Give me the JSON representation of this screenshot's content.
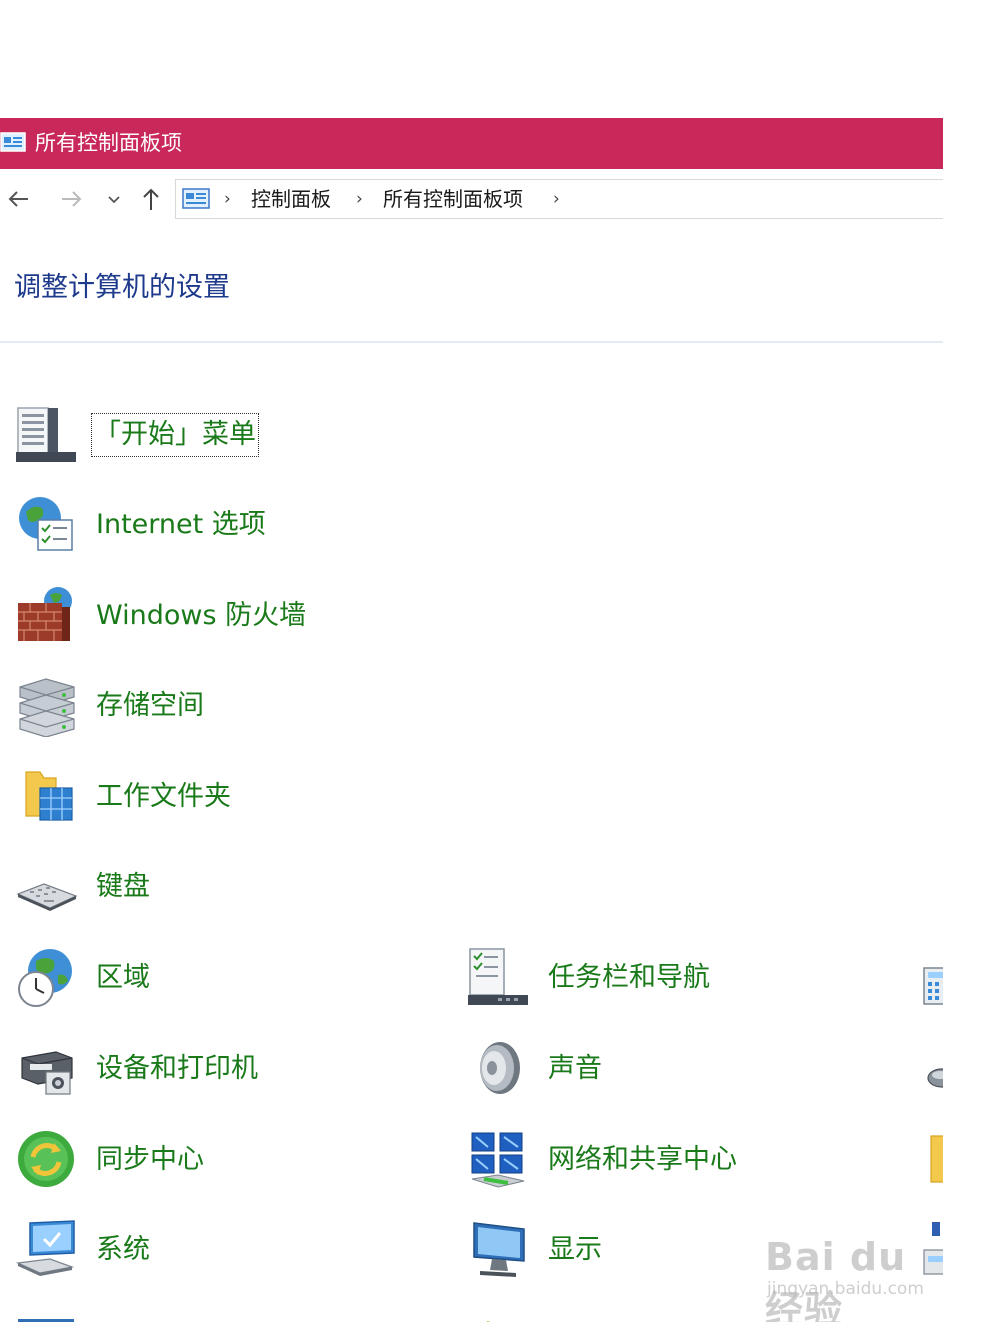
{
  "window": {
    "title": "所有控制面板项"
  },
  "navbar": {
    "back_icon": "arrow-left-icon",
    "forward_icon": "arrow-right-icon",
    "recent_icon": "chevron-down-icon",
    "up_icon": "arrow-up-icon",
    "breadcrumb": [
      "控制面板",
      "所有控制面板项"
    ],
    "separator": "›"
  },
  "main": {
    "heading": "调整计算机的设置",
    "column1": [
      {
        "label": "「开始」菜单",
        "icon": "start-menu-icon"
      },
      {
        "label": "Internet 选项",
        "icon": "internet-options-icon"
      },
      {
        "label": "Windows 防火墙",
        "icon": "firewall-icon"
      },
      {
        "label": "存储空间",
        "icon": "storage-spaces-icon"
      },
      {
        "label": "工作文件夹",
        "icon": "work-folders-icon"
      },
      {
        "label": "键盘",
        "icon": "keyboard-icon"
      },
      {
        "label": "区域",
        "icon": "region-icon"
      },
      {
        "label": "设备和打印机",
        "icon": "devices-printers-icon"
      },
      {
        "label": "同步中心",
        "icon": "sync-center-icon"
      },
      {
        "label": "系统",
        "icon": "system-icon"
      }
    ],
    "column2": [
      {
        "label": "任务栏和导航",
        "icon": "taskbar-icon"
      },
      {
        "label": "声音",
        "icon": "sound-icon"
      },
      {
        "label": "网络和共享中心",
        "icon": "network-sharing-icon"
      },
      {
        "label": "显示",
        "icon": "display-icon"
      }
    ]
  },
  "watermark": {
    "brand": "Bai du 经验",
    "url": "jingyan.baidu.com"
  },
  "colors": {
    "titlebar": "#c8285a",
    "heading": "#1e3a8c",
    "item_label": "#1a7a1a"
  }
}
